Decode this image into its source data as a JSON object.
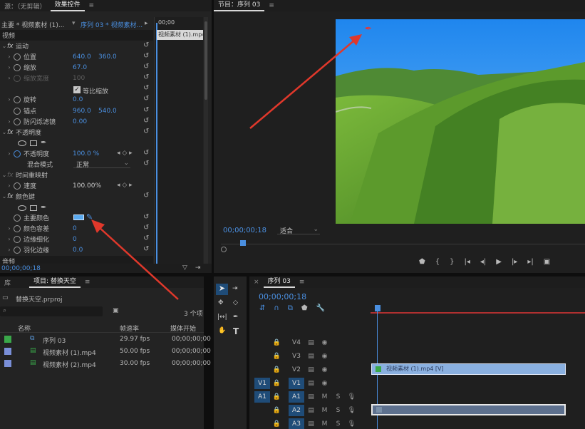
{
  "effect_panel": {
    "tab_source": "源：（无剪辑）",
    "tab_effect": "效果控件",
    "menu_icon": "≡",
    "master_label": "主要 * 视频素材 (1)...",
    "sequence_label": "序列 03 * 视频素材...",
    "ruler_start": "00;00",
    "clip_label": "视频素材 (1).mp4",
    "section_video": "视频",
    "motion": "运动",
    "position": "位置",
    "position_x": "640.0",
    "position_y": "360.0",
    "scale": "缩放",
    "scale_value": "67.0",
    "scale_width": "缩放宽度",
    "scale_width_value": "100",
    "uniform_scale": "等比缩放",
    "rotation": "旋转",
    "rotation_value": "0.0",
    "anchor": "锚点",
    "anchor_x": "960.0",
    "anchor_y": "540.0",
    "flicker": "防闪烁滤镜",
    "flicker_value": "0.00",
    "opacity_group": "不透明度",
    "opacity": "不透明度",
    "opacity_value": "100.0 %",
    "blend_mode": "混合模式",
    "blend_value": "正常",
    "time_remap": "时间重映射",
    "speed": "速度",
    "speed_value": "100.00%",
    "color_key": "颜色键",
    "key_color": "主要颜色",
    "color_tolerance": "颜色容差",
    "color_tolerance_value": "0",
    "edge_thin": "边缘细化",
    "edge_thin_value": "0",
    "feather": "羽化边缘",
    "feather_value": "0.0",
    "section_audio": "音频",
    "timecode": "00;00;00;18",
    "key_color_hex": "#5aaaf0"
  },
  "program": {
    "title": "节目：序列 03",
    "menu_icon": "≡",
    "timecode": "00;00;00;18",
    "zoom": "适合",
    "buttons": [
      "marker-icon",
      "mark-in-icon",
      "mark-out-icon",
      "go-to-in-icon",
      "step-back-icon",
      "play-icon",
      "step-forward-icon",
      "go-to-out-icon",
      "export-frame-icon"
    ],
    "sky_colors": [
      "#2a8ff0",
      "#6fb8f5"
    ],
    "grass_colors": [
      "#3f7a1f",
      "#7ab83a"
    ]
  },
  "project": {
    "tab_library": "库",
    "tab_project": "项目: 替换天空",
    "menu_icon": "≡",
    "filename": "替换天空.prproj",
    "item_count": "3 个项",
    "columns": [
      "名称",
      "帧速率",
      "媒体开始"
    ],
    "items": [
      {
        "name": "序列 03",
        "fps": "29.97 fps",
        "start": "00;00;00;00",
        "color": "#3aa84a"
      },
      {
        "name": "视频素材 (1).mp4",
        "fps": "50.00 fps",
        "start": "00;00;00;00",
        "color": "#7a8fd8"
      },
      {
        "name": "视频素材 (2).mp4",
        "fps": "30.00 fps",
        "start": "00;00;00;00",
        "color": "#7a8fd8"
      }
    ]
  },
  "timeline": {
    "title": "序列 03",
    "menu_icon": "≡",
    "timecode": "00;00;00;18",
    "tracks": [
      {
        "name": "V4",
        "src": "",
        "type": "video"
      },
      {
        "name": "V3",
        "src": "",
        "type": "video"
      },
      {
        "name": "V2",
        "src": "",
        "type": "video"
      },
      {
        "name": "V1",
        "src": "V1",
        "type": "video"
      },
      {
        "name": "A1",
        "src": "A1",
        "type": "audio"
      },
      {
        "name": "A2",
        "src": "",
        "type": "audio"
      },
      {
        "name": "A3",
        "src": "",
        "type": "audio"
      }
    ],
    "mute_label": "M",
    "solo_label": "S",
    "video_clip_label": "视频素材 (1).mp4 [V]"
  }
}
